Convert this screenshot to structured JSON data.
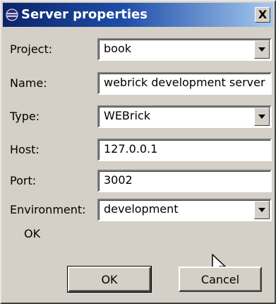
{
  "window": {
    "title": "Server properties",
    "close_label": "X"
  },
  "form": {
    "project": {
      "label": "Project:",
      "value": "book"
    },
    "name": {
      "label": "Name:",
      "value": "webrick development server"
    },
    "type": {
      "label": "Type:",
      "value": "WEBrick"
    },
    "host": {
      "label": "Host:",
      "value": "127.0.0.1"
    },
    "port": {
      "label": "Port:",
      "value": "3002"
    },
    "environment": {
      "label": "Environment:",
      "value": "development"
    }
  },
  "status": {
    "text": "OK"
  },
  "buttons": {
    "ok_label": "OK",
    "cancel_label": "Cancel"
  },
  "colors": {
    "titlebar_start": "#0a246a",
    "titlebar_end": "#a6caf0",
    "dialog_face": "#d4d0c8"
  },
  "icons": {
    "title": "eclipse-icon",
    "close": "close-icon",
    "dropdown": "chevron-down-icon",
    "cursor": "mouse-pointer-icon"
  }
}
